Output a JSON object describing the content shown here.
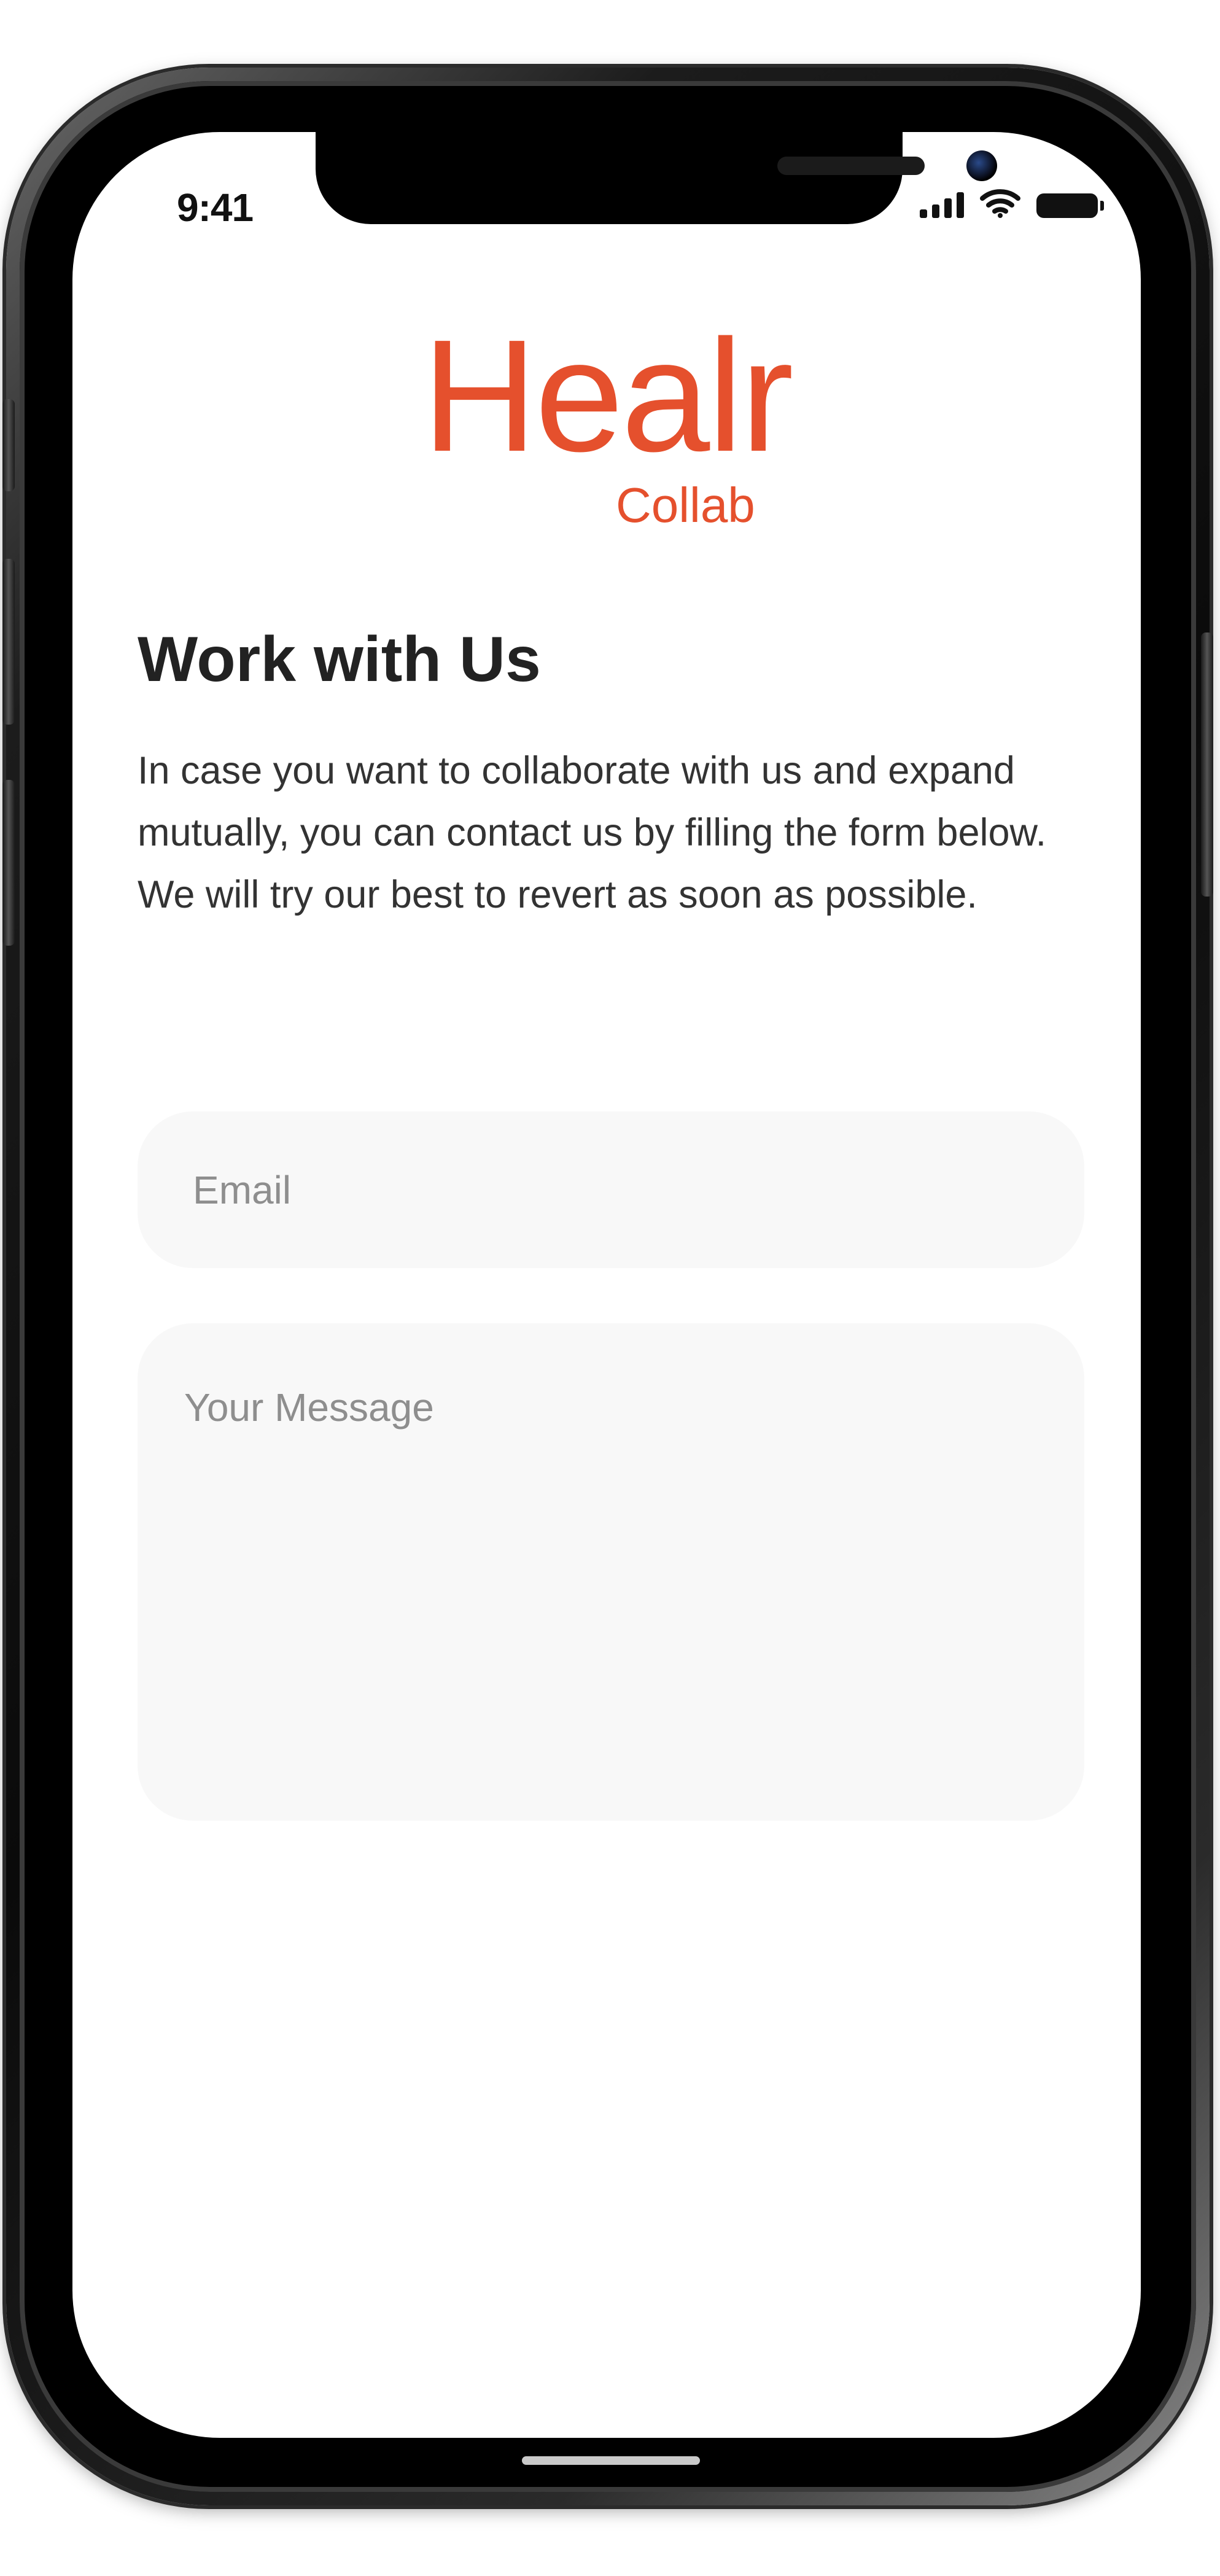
{
  "status_bar": {
    "time": "9:41",
    "icons": [
      "signal-icon",
      "wifi-icon",
      "battery-icon"
    ]
  },
  "brand": {
    "name": "Healr",
    "subtitle": "Collab",
    "color": "#e5502d"
  },
  "page": {
    "title": "Work with Us",
    "description_lines": [
      "In case you want to collaborate with us and expand mutually, you can contact us by filling the form below.",
      "We will try our best to revert as soon as possible."
    ]
  },
  "form": {
    "email_placeholder": "Email",
    "message_placeholder": "Your Message"
  }
}
